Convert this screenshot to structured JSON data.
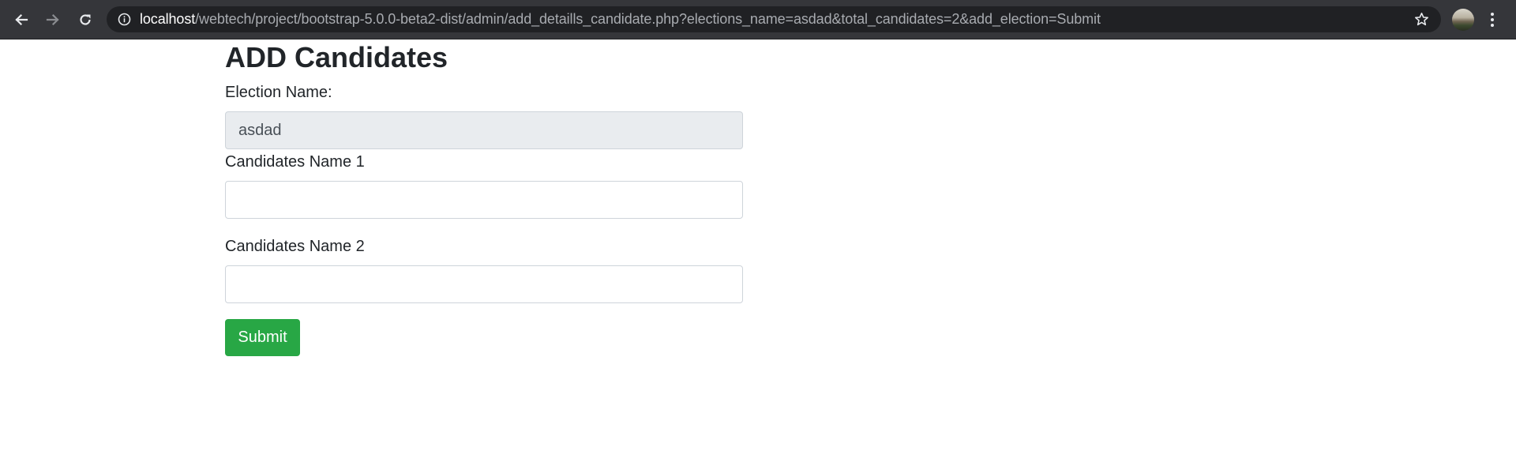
{
  "browser": {
    "url_host": "localhost",
    "url_rest": "/webtech/project/bootstrap-5.0.0-beta2-dist/admin/add_detaills_candidate.php?elections_name=asdad&total_candidates=2&add_election=Submit",
    "icons": {
      "back": "arrow-left-icon",
      "forward": "arrow-right-icon",
      "reload": "reload-icon",
      "info": "info-icon",
      "bookmark": "star-icon",
      "profile": "avatar",
      "menu": "kebab-menu-icon"
    }
  },
  "form": {
    "title": "ADD Candidates",
    "election_label": "Election Name:",
    "election_value": "asdad",
    "candidates": [
      {
        "label": "Candidates Name 1",
        "value": ""
      },
      {
        "label": "Candidates Name 2",
        "value": ""
      }
    ],
    "submit_label": "Submit"
  },
  "colors": {
    "toolbar": "#35363a",
    "omnibox": "#202124",
    "submit": "#28a745",
    "readonly_field": "#e9ecef"
  }
}
